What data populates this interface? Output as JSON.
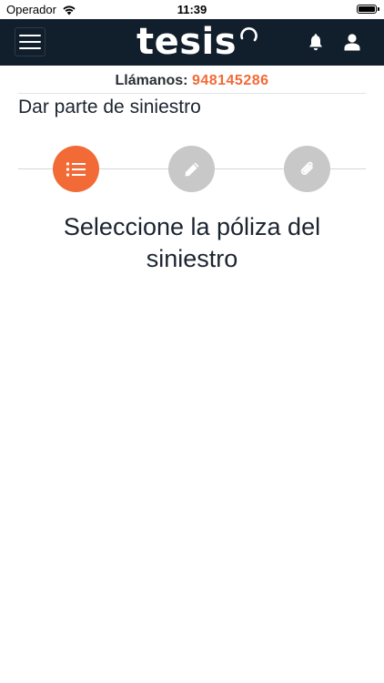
{
  "status_bar": {
    "carrier": "Operador",
    "time": "11:39"
  },
  "navbar": {
    "logo_text": "tesis"
  },
  "callbar": {
    "label": "Llámanos:",
    "phone": "948145286"
  },
  "page_title": "Dar parte de siniestro",
  "stepper": {
    "steps": [
      {
        "icon": "list-icon",
        "state": "active"
      },
      {
        "icon": "pencil-icon",
        "state": "inactive"
      },
      {
        "icon": "paperclip-icon",
        "state": "inactive"
      }
    ]
  },
  "heading": "Seleccione la póliza del siniestro",
  "colors": {
    "navbar": "#111e2b",
    "accent": "#f26a36",
    "inactive_step": "#c8c8c8"
  }
}
